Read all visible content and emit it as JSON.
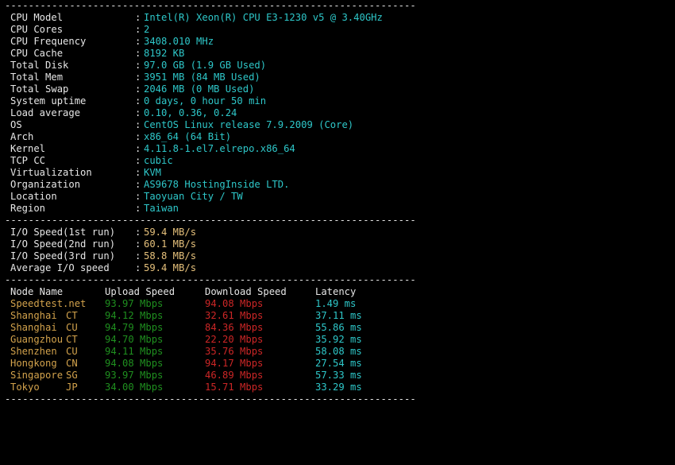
{
  "separator": "----------------------------------------------------------------------",
  "colors": {
    "background": "#000000",
    "label": "#e6e6e6",
    "system_value": "#2ec7c9",
    "io_value": "#e5c07b",
    "node": "#d2a24c",
    "upload": "#1f8f1f",
    "download": "#cc2626",
    "latency": "#2ec7c9"
  },
  "system": [
    {
      "key": "CPU Model",
      "value": "Intel(R) Xeon(R) CPU E3-1230 v5 @ 3.40GHz"
    },
    {
      "key": "CPU Cores",
      "value": "2"
    },
    {
      "key": "CPU Frequency",
      "value": "3408.010 MHz"
    },
    {
      "key": "CPU Cache",
      "value": "8192 KB"
    },
    {
      "key": "Total Disk",
      "value": "97.0 GB (1.9 GB Used)"
    },
    {
      "key": "Total Mem",
      "value": "3951 MB (84 MB Used)"
    },
    {
      "key": "Total Swap",
      "value": "2046 MB (0 MB Used)"
    },
    {
      "key": "System uptime",
      "value": "0 days, 0 hour 50 min"
    },
    {
      "key": "Load average",
      "value": "0.10, 0.36, 0.24"
    },
    {
      "key": "OS",
      "value": "CentOS Linux release 7.9.2009 (Core)"
    },
    {
      "key": "Arch",
      "value": "x86_64 (64 Bit)"
    },
    {
      "key": "Kernel",
      "value": "4.11.8-1.el7.elrepo.x86_64"
    },
    {
      "key": "TCP CC",
      "value": "cubic"
    },
    {
      "key": "Virtualization",
      "value": "KVM"
    },
    {
      "key": "Organization",
      "value": "AS9678 HostingInside LTD."
    },
    {
      "key": "Location",
      "value": "Taoyuan City / TW"
    },
    {
      "key": "Region",
      "value": "Taiwan"
    }
  ],
  "io": [
    {
      "key": "I/O Speed(1st run)",
      "value": "59.4 MB/s"
    },
    {
      "key": "I/O Speed(2nd run)",
      "value": "60.1 MB/s"
    },
    {
      "key": "I/O Speed(3rd run)",
      "value": "58.8 MB/s"
    },
    {
      "key": "Average I/O speed",
      "value": "59.4 MB/s"
    }
  ],
  "speed_headers": {
    "node": "Node Name",
    "upload": "Upload Speed",
    "download": "Download Speed",
    "latency": "Latency"
  },
  "speed_rows": [
    {
      "name": "Speedtest.net",
      "isp": "",
      "upload": "93.97 Mbps",
      "download": "94.08 Mbps",
      "latency": "1.49 ms"
    },
    {
      "name": "Shanghai",
      "isp": "CT",
      "upload": "94.12 Mbps",
      "download": "32.61 Mbps",
      "latency": "37.11 ms"
    },
    {
      "name": "Shanghai",
      "isp": "CU",
      "upload": "94.79 Mbps",
      "download": "84.36 Mbps",
      "latency": "55.86 ms"
    },
    {
      "name": "Guangzhou",
      "isp": "CT",
      "upload": "94.70 Mbps",
      "download": "22.20 Mbps",
      "latency": "35.92 ms"
    },
    {
      "name": "Shenzhen",
      "isp": "CU",
      "upload": "94.11 Mbps",
      "download": "35.76 Mbps",
      "latency": "58.08 ms"
    },
    {
      "name": "Hongkong",
      "isp": "CN",
      "upload": "94.08 Mbps",
      "download": "94.17 Mbps",
      "latency": "27.54 ms"
    },
    {
      "name": "Singapore",
      "isp": "SG",
      "upload": "93.97 Mbps",
      "download": "46.89 Mbps",
      "latency": "57.33 ms"
    },
    {
      "name": "Tokyo",
      "isp": "JP",
      "upload": "34.00 Mbps",
      "download": "15.71 Mbps",
      "latency": "33.29 ms"
    }
  ]
}
